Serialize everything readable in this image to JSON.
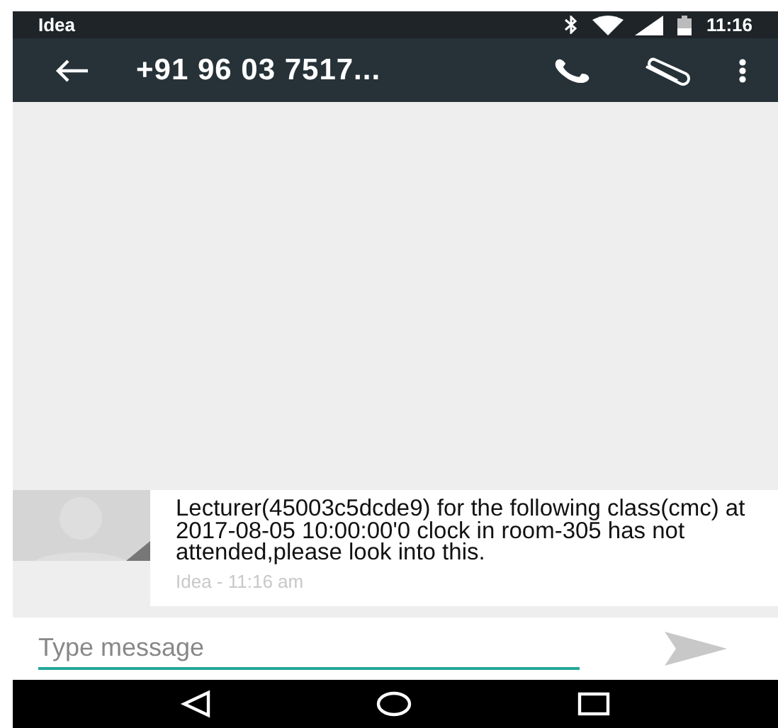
{
  "status_bar": {
    "carrier": "Idea",
    "time": "11:16"
  },
  "app_bar": {
    "title": "+91 96 03 7517..."
  },
  "messages": [
    {
      "text": "Lecturer(45003c5dcde9) for the following class(cmc) at 2017-08-05 10:00:00'0 clock in room-305 has not attended,please look into this.",
      "meta": "Idea - 11:16 am"
    }
  ],
  "composer": {
    "placeholder": "Type message"
  }
}
